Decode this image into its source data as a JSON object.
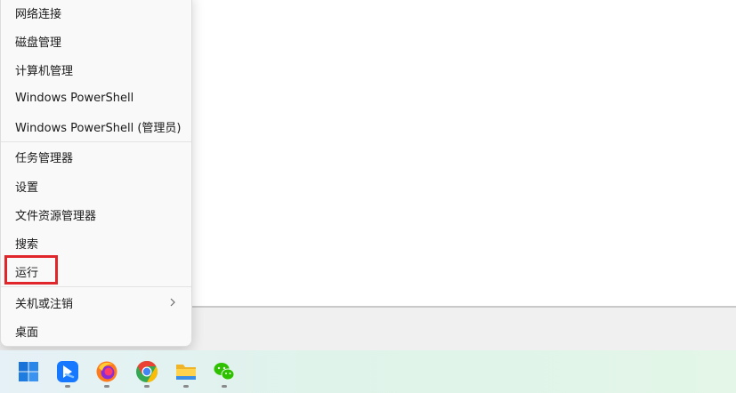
{
  "menu": {
    "items": [
      {
        "label": "网络连接"
      },
      {
        "label": "磁盘管理"
      },
      {
        "label": "计算机管理"
      },
      {
        "label": "Windows PowerShell"
      },
      {
        "label": "Windows PowerShell (管理员)"
      },
      {
        "label": "任务管理器"
      },
      {
        "label": "设置"
      },
      {
        "label": "文件资源管理器"
      },
      {
        "label": "搜索"
      },
      {
        "label": "运行"
      },
      {
        "label": "关机或注销",
        "has_submenu": true
      },
      {
        "label": "桌面"
      }
    ],
    "highlighted_item": "运行",
    "highlight_color": "#e0262b"
  },
  "taskbar": {
    "icons": [
      {
        "name": "windows-start-icon",
        "running": false
      },
      {
        "name": "feishu-app-icon",
        "running": true
      },
      {
        "name": "firefox-icon",
        "running": true
      },
      {
        "name": "chrome-icon",
        "running": true
      },
      {
        "name": "file-explorer-icon",
        "running": true
      },
      {
        "name": "wechat-icon",
        "running": true
      }
    ]
  }
}
